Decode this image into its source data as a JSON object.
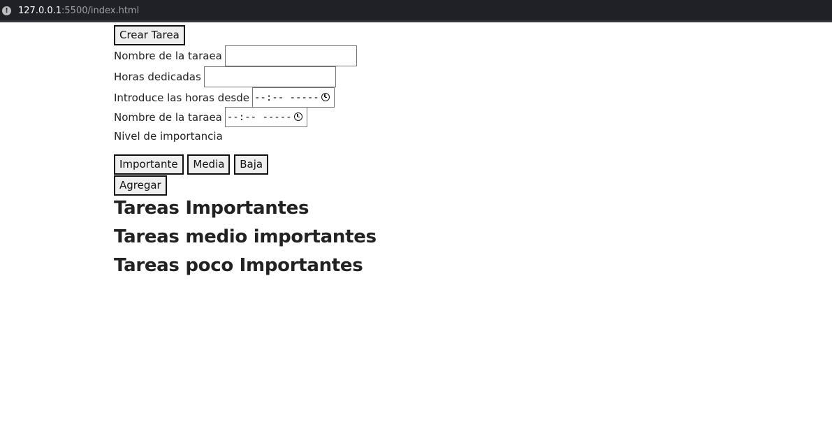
{
  "browser": {
    "url_host": "127.0.0.1",
    "url_rest": ":5500/index.html",
    "security_icon": "info-icon"
  },
  "form": {
    "create_button": "Crear Tarea",
    "task_name_label": "Nombre de la taraea",
    "task_name_value": "",
    "hours_label": "Horas dedicadas",
    "hours_value": "",
    "from_label": "Introduce las horas desde",
    "from_value": "--:--  -----",
    "to_label": "Nombre de la taraea",
    "to_value": "--:--  -----",
    "importance_label": "Nivel de importancia",
    "importance_options": [
      "Importante",
      "Media",
      "Baja"
    ],
    "add_button": "Agregar"
  },
  "sections": [
    "Tareas Importantes",
    "Tareas medio importantes",
    "Tareas poco Importantes"
  ]
}
